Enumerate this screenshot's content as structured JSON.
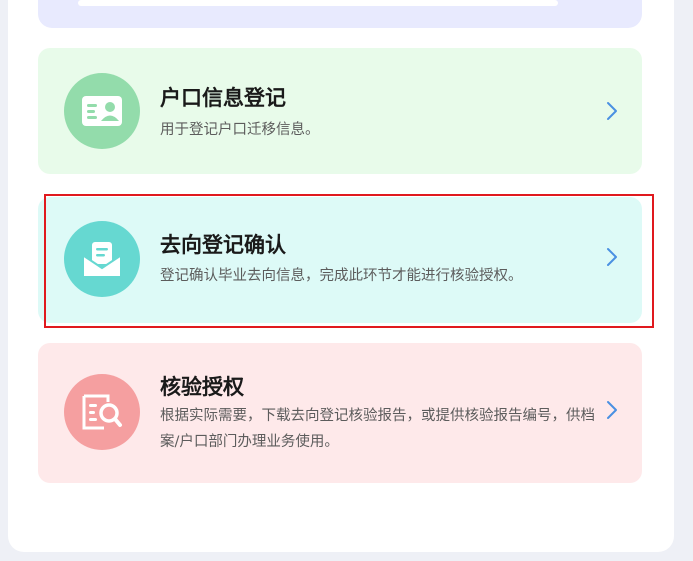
{
  "cards": [
    {
      "title": "户口信息登记",
      "desc": "用于登记户口迁移信息。",
      "icon": "id-card-icon",
      "bg": "#e8fbea",
      "icon_bg": "#93dcab"
    },
    {
      "title": "去向登记确认",
      "desc": "登记确认毕业去向信息，完成此环节才能进行核验授权。",
      "icon": "document-envelope-icon",
      "bg": "#ddfaf7",
      "icon_bg": "#66d8d1",
      "highlighted": true
    },
    {
      "title": "核验授权",
      "desc": "根据实际需要，下载去向登记核验报告，或提供核验报告编号，供档案/户口部门办理业务使用。",
      "icon": "search-document-icon",
      "bg": "#fee9ea",
      "icon_bg": "#f59fa0"
    }
  ],
  "colors": {
    "chevron": "#4a90e2",
    "highlight_border": "#e0191e",
    "title": "#1a1a1a",
    "desc": "#5c5c5c"
  }
}
